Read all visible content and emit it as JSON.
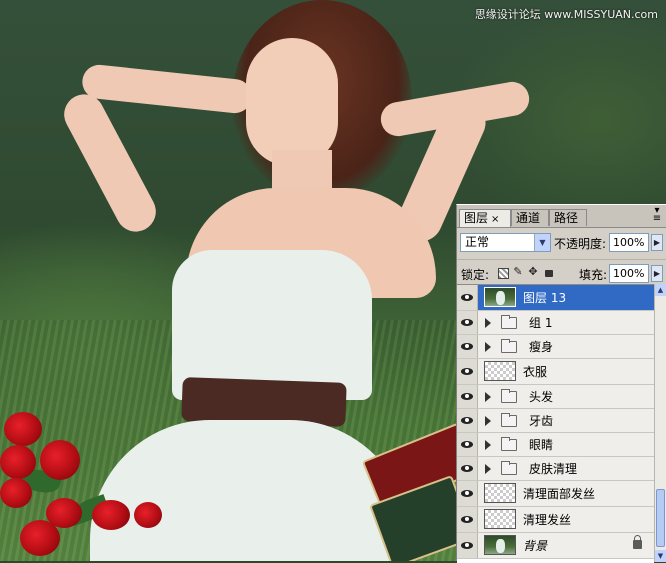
{
  "watermark": "思缘设计论坛 www.MISSYUAN.com",
  "panel": {
    "tabs": [
      {
        "label": "图层",
        "close": "×"
      },
      {
        "label": "通道"
      },
      {
        "label": "路径"
      }
    ],
    "menu_icon": "panel-menu-icon",
    "blend_mode": "正常",
    "opacity_label": "不透明度:",
    "opacity_value": "100%",
    "lock_label": "锁定:",
    "fill_label": "填充:",
    "fill_value": "100%",
    "layers": [
      {
        "name": "图层 13",
        "kind": "photo",
        "selected": true
      },
      {
        "name": "组 1",
        "kind": "group"
      },
      {
        "name": "瘦身",
        "kind": "group"
      },
      {
        "name": "衣服",
        "kind": "layer"
      },
      {
        "name": "头发",
        "kind": "group"
      },
      {
        "name": "牙齿",
        "kind": "group"
      },
      {
        "name": "眼睛",
        "kind": "group"
      },
      {
        "name": "皮肤清理",
        "kind": "group"
      },
      {
        "name": "清理面部发丝",
        "kind": "layer"
      },
      {
        "name": "清理发丝",
        "kind": "layer"
      },
      {
        "name": "背景",
        "kind": "photo",
        "locked": true
      }
    ]
  },
  "colors": {
    "selection": "#316ac5",
    "panel_bg": "#d4d0c8"
  }
}
